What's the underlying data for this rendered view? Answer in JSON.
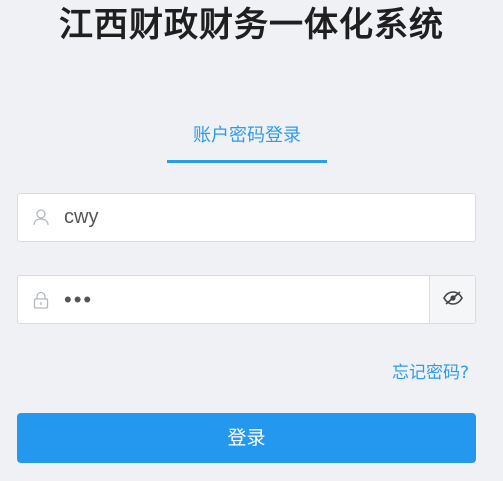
{
  "header": {
    "title": "江西财政财务一体化系统"
  },
  "tabs": [
    {
      "label": "账户密码登录",
      "active": true
    }
  ],
  "form": {
    "username": {
      "value": "cwy",
      "icon": "user-icon"
    },
    "password": {
      "value": "•••",
      "icon": "lock-icon",
      "toggle_icon": "eye-icon"
    },
    "forgot_label": "忘记密码?",
    "submit_label": "登录"
  },
  "colors": {
    "accent": "#2d9bec",
    "button": "#2398ee",
    "background": "#eff1f5",
    "title": "#1f1f1f"
  }
}
